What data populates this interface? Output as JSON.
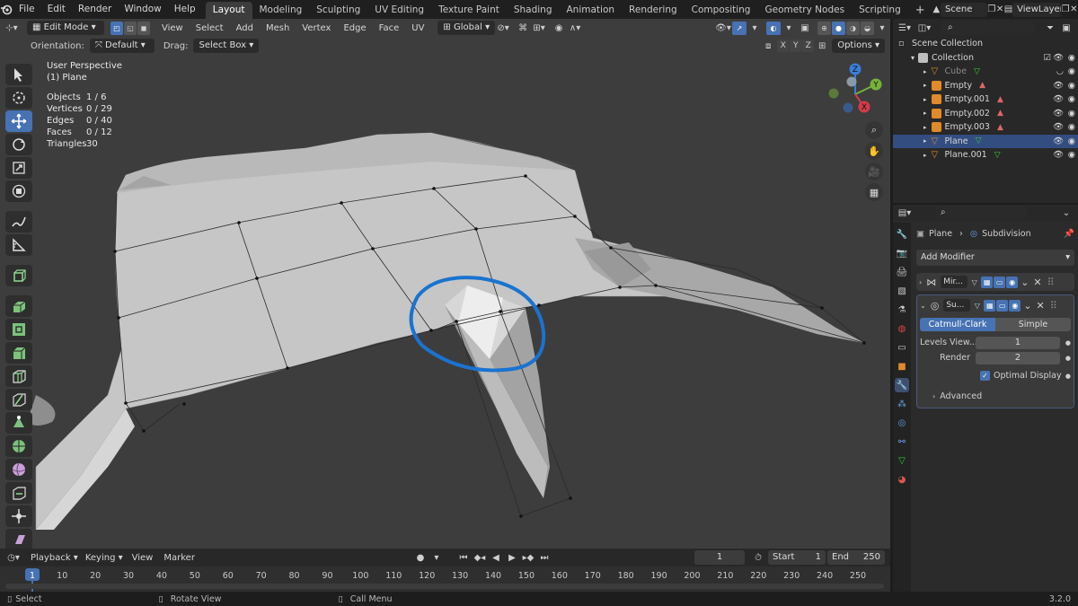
{
  "topbar": {
    "menus": [
      "File",
      "Edit",
      "Render",
      "Window",
      "Help"
    ],
    "workspaces": [
      "Layout",
      "Modeling",
      "Sculpting",
      "UV Editing",
      "Texture Paint",
      "Shading",
      "Animation",
      "Rendering",
      "Compositing",
      "Geometry Nodes",
      "Scripting"
    ],
    "active_workspace": "Layout",
    "add_tab": "+",
    "scene": "Scene",
    "view_layer": "ViewLayer"
  },
  "viewport": {
    "mode": "Edit Mode",
    "menus": [
      "View",
      "Select",
      "Add",
      "Mesh",
      "Vertex",
      "Edge",
      "Face",
      "UV"
    ],
    "transform": "Global",
    "orientation_label": "Orientation:",
    "orientation_value": "Default",
    "drag_label": "Drag:",
    "drag_value": "Select Box",
    "axes": [
      "X",
      "Y",
      "Z"
    ],
    "options": "Options",
    "overlay_title": "User Perspective",
    "overlay_object": "(1) Plane",
    "stats": [
      {
        "label": "Objects",
        "value": "1 / 6"
      },
      {
        "label": "Vertices",
        "value": "0 / 29"
      },
      {
        "label": "Edges",
        "value": "0 / 40"
      },
      {
        "label": "Faces",
        "value": "0 / 12"
      },
      {
        "label": "Triangles",
        "value": "30"
      }
    ],
    "gizmo": {
      "x": "X",
      "y": "Y",
      "z": "Z"
    },
    "annotation_color": "#1a73d0"
  },
  "outliner": {
    "search_placeholder": "",
    "scene_collection": "Scene Collection",
    "collection": "Collection",
    "items": [
      {
        "name": "Cube",
        "icon": "mesh-icon",
        "dim": true,
        "selected": false
      },
      {
        "name": "Empty",
        "icon": "empty-icon",
        "dim": false,
        "selected": false
      },
      {
        "name": "Empty.001",
        "icon": "empty-icon",
        "dim": false,
        "selected": false
      },
      {
        "name": "Empty.002",
        "icon": "empty-icon",
        "dim": false,
        "selected": false
      },
      {
        "name": "Empty.003",
        "icon": "empty-icon",
        "dim": false,
        "selected": false
      },
      {
        "name": "Plane",
        "icon": "mesh-icon",
        "dim": false,
        "selected": true
      },
      {
        "name": "Plane.001",
        "icon": "mesh-icon",
        "dim": false,
        "selected": false
      }
    ]
  },
  "properties": {
    "breadcrumb_object": "Plane",
    "breadcrumb_modifier": "Subdivision",
    "add_modifier": "Add Modifier",
    "modifiers": [
      {
        "name": "Mir...",
        "icon": "mirror-icon"
      },
      {
        "name": "Su...",
        "icon": "subdivision-icon"
      }
    ],
    "subdiv_types": [
      "Catmull-Clark",
      "Simple"
    ],
    "active_type": "Catmull-Clark",
    "levels_viewport_label": "Levels View...",
    "levels_viewport_value": "1",
    "render_label": "Render",
    "render_value": "2",
    "optimal_display": "Optimal Display",
    "advanced": "Advanced"
  },
  "timeline": {
    "menus": [
      "Playback",
      "Keying",
      "View",
      "Marker"
    ],
    "current_frame": "1",
    "start_label": "Start",
    "start_value": "1",
    "end_label": "End",
    "end_value": "250",
    "ruler_labels": [
      "1",
      "10",
      "20",
      "30",
      "40",
      "50",
      "60",
      "70",
      "80",
      "90",
      "100",
      "110",
      "120",
      "130",
      "140",
      "150",
      "160",
      "170",
      "180",
      "190",
      "200",
      "210",
      "220",
      "230",
      "240",
      "250"
    ]
  },
  "statusbar": {
    "select": "Select",
    "rotate": "Rotate View",
    "call_menu": "Call Menu",
    "version": "3.2.0"
  }
}
